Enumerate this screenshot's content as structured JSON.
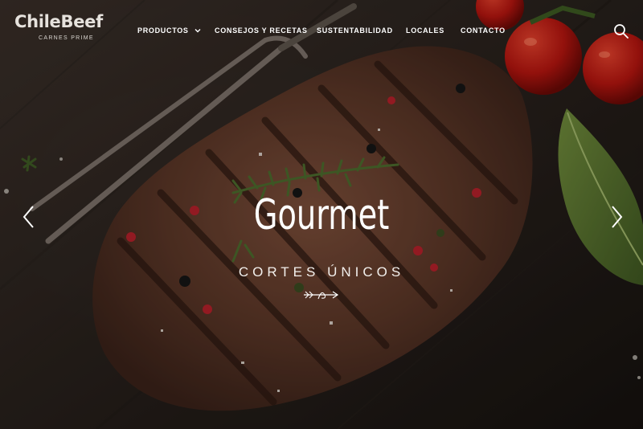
{
  "brand": {
    "logo_text": "ChileBeef",
    "tagline": "CARNES PRIME"
  },
  "nav": {
    "items": [
      {
        "label": "PRODUCTOS",
        "has_dropdown": true
      },
      {
        "label": "CONSEJOS Y RECETAS",
        "has_dropdown": false
      },
      {
        "label": "SUSTENTABILIDAD",
        "has_dropdown": false
      },
      {
        "label": "LOCALES",
        "has_dropdown": false
      },
      {
        "label": "CONTACTO",
        "has_dropdown": false
      }
    ],
    "search_icon": "search-icon"
  },
  "slider": {
    "title": "Gourmet",
    "subtitle": "CORTES ÚNICOS",
    "prev_icon": "chevron-left-icon",
    "next_icon": "chevron-right-icon",
    "ornament_icon": "arrow-ornament-icon"
  },
  "colors": {
    "text": "#ffffff",
    "background": "#1a1512",
    "meat": "#5a3a2c",
    "tomato": "#b3150f",
    "leaf": "#4d6a2a"
  }
}
